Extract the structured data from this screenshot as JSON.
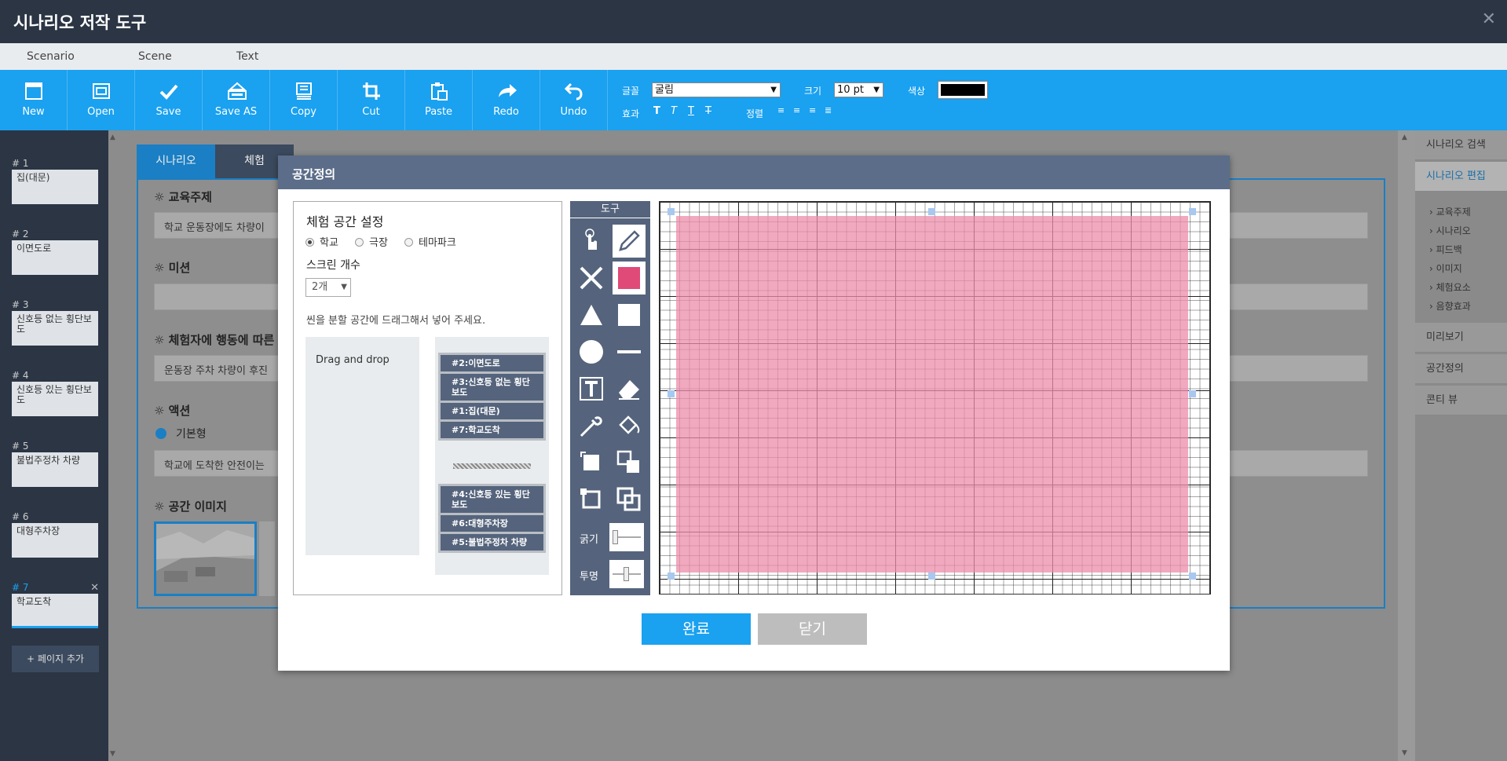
{
  "app": {
    "title": "시나리오 저작 도구"
  },
  "menu": [
    "Scenario",
    "Scene",
    "Text"
  ],
  "toolbar": {
    "buttons": [
      {
        "label": "New",
        "icon": "new-icon"
      },
      {
        "label": "Open",
        "icon": "open-icon"
      },
      {
        "label": "Save",
        "icon": "save-icon"
      },
      {
        "label": "Save AS",
        "icon": "save-as-icon"
      },
      {
        "label": "Copy",
        "icon": "copy-icon"
      },
      {
        "label": "Cut",
        "icon": "cut-icon"
      },
      {
        "label": "Paste",
        "icon": "paste-icon"
      },
      {
        "label": "Redo",
        "icon": "redo-icon"
      },
      {
        "label": "Undo",
        "icon": "undo-icon"
      }
    ],
    "font_label": "글꼴",
    "font_value": "굴림",
    "size_label": "크기",
    "size_value": "10 pt",
    "color_label": "색상",
    "color_value": "#000000",
    "effect_label": "효과",
    "align_label": "정렬"
  },
  "pages": [
    {
      "num": "# 1",
      "title": "집(대문)"
    },
    {
      "num": "# 2",
      "title": "이면도로"
    },
    {
      "num": "# 3",
      "title": "신호등 없는 횡단보도"
    },
    {
      "num": "# 4",
      "title": "신호등 있는 횡단보도"
    },
    {
      "num": "# 5",
      "title": "불법주정차 차량"
    },
    {
      "num": "# 6",
      "title": "대형주차장"
    },
    {
      "num": "# 7",
      "title": "학교도착"
    }
  ],
  "add_page": "+ 페이지 추가",
  "right_panel": {
    "items": [
      "시나리오 검색",
      "시나리오 편집",
      "미리보기",
      "공간정의",
      "콘티 뷰"
    ],
    "sub_items": [
      "› 교육주제",
      "› 시나리오",
      "› 피드백",
      "› 이미지",
      "› 체험요소",
      "› 음향효과"
    ]
  },
  "background": {
    "tabs": [
      "시나리오",
      "체험"
    ],
    "sections": [
      {
        "head": "교육주제",
        "value": "학교 운동장에도 차량이"
      },
      {
        "head": "미션",
        "value": ""
      },
      {
        "head": "체험자에 행동에 따른",
        "value": "운동장 주차 차량이 후진"
      },
      {
        "head": "액션",
        "value": "학교에 도착한 안전이는"
      },
      {
        "head": "공간 이미지",
        "value": ""
      }
    ],
    "radio_default": "기본형"
  },
  "dialog": {
    "title": "공간정의",
    "settings_title": "체험 공간 설정",
    "venues": [
      "학교",
      "극장",
      "테마파크"
    ],
    "screen_count_label": "스크린 개수",
    "screen_count_value": "2개",
    "instruction": "씬을 분할 공간에 드래그해서 넣어 주세요.",
    "drag_placeholder": "Drag and drop",
    "group1": [
      "#2:이면도로",
      "#3:신호등 없는 횡단보도",
      "#1:집(대문)",
      "#7:학교도착"
    ],
    "group2": [
      "#4:신호등 있는 횡단보도",
      "#6:대형주차장",
      "#5:불법주정차 차량"
    ],
    "tools_title": "도구",
    "thickness_label": "굵기",
    "opacity_label": "투명",
    "ok": "완료",
    "close": "닫기",
    "fill_color": "#ec8caa"
  }
}
